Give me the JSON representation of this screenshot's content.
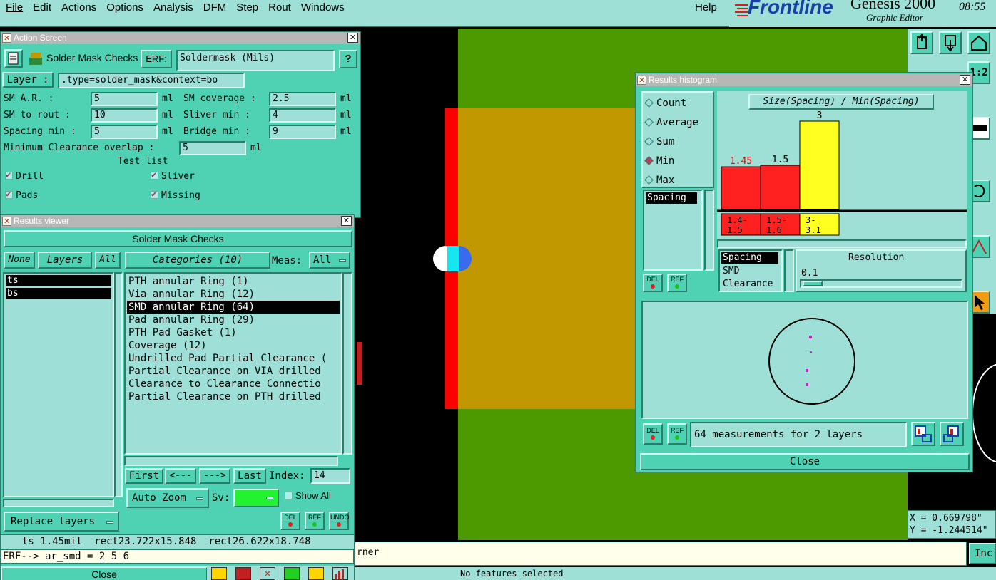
{
  "menu": {
    "items": [
      "File",
      "Edit",
      "Actions",
      "Options",
      "Analysis",
      "DFM",
      "Step",
      "Rout",
      "Windows"
    ],
    "help": "Help",
    "brand": "Frontline",
    "product": "Genesis 2000",
    "subtitle": "Graphic Editor",
    "clock": "08:55"
  },
  "action_screen": {
    "title": "Action Screen",
    "name": "Solder Mask Checks",
    "erf_label": "ERF:",
    "erf_value": "Soldermask (Mils)",
    "help": "?",
    "layer_label": "Layer :",
    "layer_value": ".type=solder_mask&context=bo",
    "params": [
      {
        "label": "SM A.R.      :",
        "value": "5",
        "unit": "ml"
      },
      {
        "label": "SM coverage :",
        "value": "2.5",
        "unit": "ml"
      },
      {
        "label": "SM to rout   :",
        "value": "10",
        "unit": "ml"
      },
      {
        "label": "Sliver  min :",
        "value": "4",
        "unit": "ml"
      },
      {
        "label": "Spacing min :",
        "value": "5",
        "unit": "ml"
      },
      {
        "label": "Bridge  min :",
        "value": "9",
        "unit": "ml"
      }
    ],
    "overlap_label": "Minimum Clearance overlap :",
    "overlap_value": "5",
    "overlap_unit": "ml",
    "test_list_label": "Test list",
    "tests": [
      "Drill",
      "Sliver",
      "Pads",
      "Missing"
    ]
  },
  "results_viewer": {
    "title": "Results viewer",
    "header": "Solder Mask Checks",
    "none": "None",
    "layers": "Layers",
    "all": "All",
    "layer_items": [
      "ts",
      "bs"
    ],
    "categories_label": "Categories (10)",
    "meas_label": "Meas:",
    "meas_value": "All",
    "categories": [
      "PTH annular Ring (1)",
      "Via annular Ring (12)",
      "SMD annular Ring (64)",
      "Pad annular Ring (29)",
      "PTH Pad Gasket (1)",
      "Coverage (12)",
      "Undrilled Pad Partial Clearance (",
      "Partial Clearance on VIA drilled",
      "Clearance to Clearance Connectio",
      "Partial Clearance on PTH drilled"
    ],
    "first": "First",
    "prev": "<---",
    "next": "--->",
    "last": "Last",
    "index_label": "Index:",
    "index_value": "14",
    "auto_zoom": "Auto Zoom",
    "sv_label": "Sv:",
    "show_all": "Show All",
    "replace_layers": "Replace layers",
    "del": "DEL",
    "ref": "REF",
    "undo": "UNDO",
    "status_line": "ts 1.45mil  rect23.722x15.848  rect26.622x18.748",
    "erf_line": "ERF--> ar_smd = 2 5 6",
    "close": "Close"
  },
  "histogram": {
    "title": "Results histogram",
    "modes": [
      "Count",
      "Average",
      "Sum",
      "Min",
      "Max"
    ],
    "selected_mode": "Min",
    "chart_title": "Size(Spacing) / Min(Spacing)",
    "bars": [
      {
        "top_label": "1.45",
        "range": "1.4-\n 1.5",
        "value": 1.45,
        "color": "#ff2020",
        "label_color": "#e00000"
      },
      {
        "top_label": "1.5",
        "range": "1.5-\n 1.6",
        "value": 1.5,
        "color": "#ff2020",
        "label_color": "#000000"
      },
      {
        "top_label": "3",
        "range": "3-\n 3.1",
        "value": 3,
        "color": "#ffff20",
        "label_color": "#000000"
      }
    ],
    "left_list": [
      "Spacing"
    ],
    "measure_list": [
      "Spacing",
      "SMD",
      "Clearance"
    ],
    "resolution_label": "Resolution",
    "resolution_value": "0.1",
    "summary": "64 measurements for 2 layers",
    "del": "DEL",
    "ref": "REF",
    "close": "Close"
  },
  "statusbar": {
    "corner_text": "rner",
    "no_features": "No features selected",
    "incl": "Incl",
    "coord_x": "X = 0.669798\"",
    "coord_y": "Y = -1.244514\""
  }
}
